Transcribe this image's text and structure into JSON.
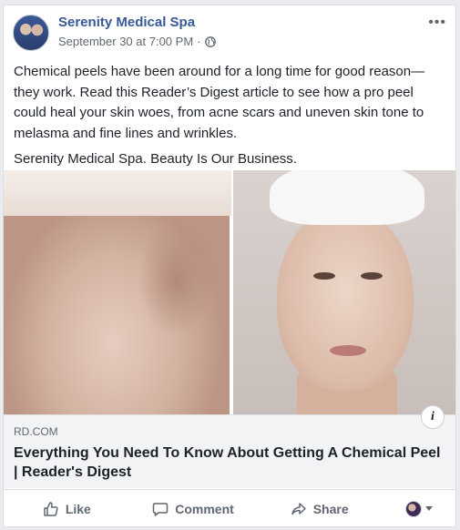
{
  "post": {
    "page_name": "Serenity Medical Spa",
    "timestamp": "September 30 at 7:00 PM",
    "separator": "·",
    "privacy_icon": "globe-icon",
    "more_icon": "more-options-icon",
    "text_paragraphs": [
      "Chemical peels have been around for a long time for good reason—they work. Read this Reader’s Digest article to see how a pro peel could heal your skin woes, from acne scars and uneven skin tone to melasma and fine lines and wrinkles.",
      "Serenity Medical Spa. Beauty Is Our Business."
    ]
  },
  "link_preview": {
    "domain": "RD.COM",
    "title": "Everything You Need To Know About Getting A Chemical Peel | Reader's Digest",
    "info_icon": "info-icon"
  },
  "actions": {
    "like": "Like",
    "comment": "Comment",
    "share": "Share"
  },
  "colors": {
    "page_name": "#385898",
    "background": "#e9ebee",
    "link_box": "#f2f3f5",
    "muted_text": "#606770"
  }
}
